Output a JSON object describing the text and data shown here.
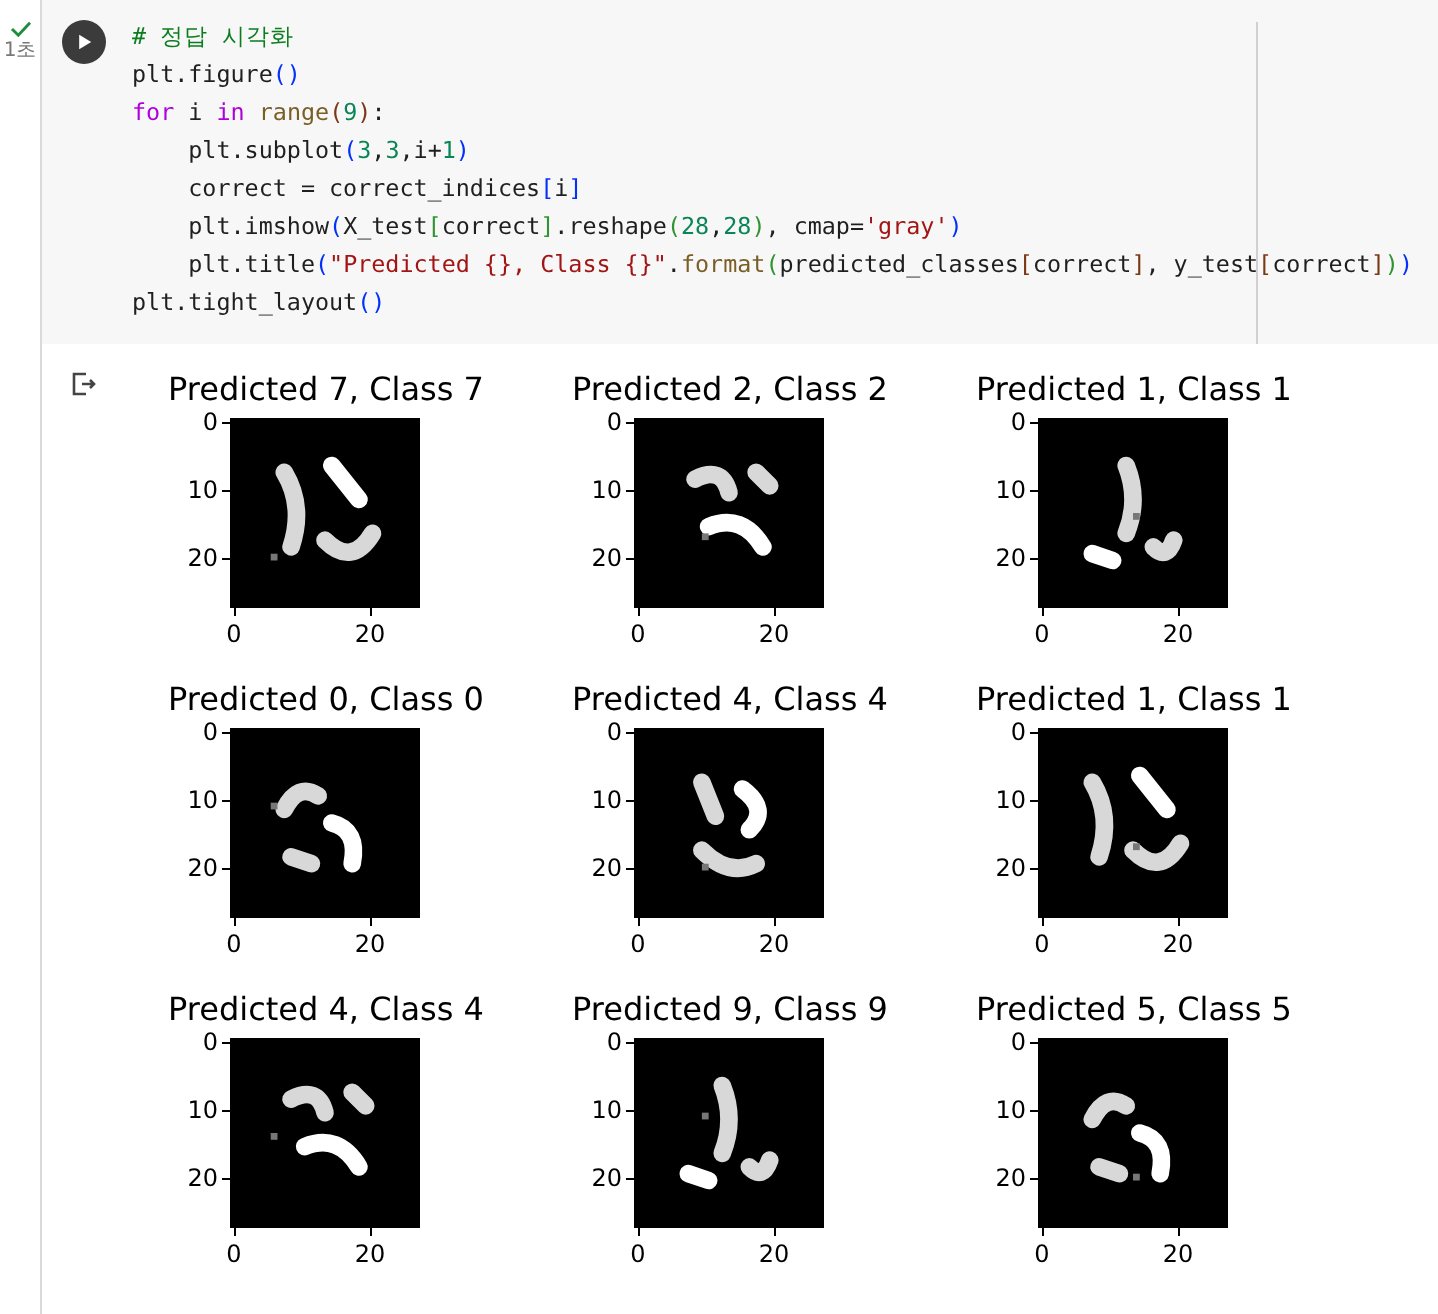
{
  "cell": {
    "status": {
      "done": true,
      "duration": "1초"
    },
    "code_lines": [
      [
        {
          "kind": "comment",
          "text": "# 정답 시각화"
        }
      ],
      [
        {
          "kind": "plain",
          "text": "plt.figure"
        },
        {
          "kind": "bracket1",
          "text": "()"
        }
      ],
      [
        {
          "kind": "keyword",
          "text": "for"
        },
        {
          "kind": "plain",
          "text": " i "
        },
        {
          "kind": "keyword",
          "text": "in"
        },
        {
          "kind": "function",
          "text": " range"
        },
        {
          "kind": "bracket3",
          "text": "("
        },
        {
          "kind": "number",
          "text": "9"
        },
        {
          "kind": "bracket3",
          "text": ")"
        },
        {
          "kind": "plain",
          "text": ":"
        }
      ],
      [
        {
          "kind": "plain",
          "text": "    plt.subplot"
        },
        {
          "kind": "bracket1",
          "text": "("
        },
        {
          "kind": "number",
          "text": "3"
        },
        {
          "kind": "plain",
          "text": ","
        },
        {
          "kind": "number",
          "text": "3"
        },
        {
          "kind": "plain",
          "text": ",i+"
        },
        {
          "kind": "number",
          "text": "1"
        },
        {
          "kind": "bracket1",
          "text": ")"
        }
      ],
      [
        {
          "kind": "plain",
          "text": "    correct = correct_indices"
        },
        {
          "kind": "bracket1",
          "text": "["
        },
        {
          "kind": "plain",
          "text": "i"
        },
        {
          "kind": "bracket1",
          "text": "]"
        }
      ],
      [
        {
          "kind": "plain",
          "text": "    plt.imshow"
        },
        {
          "kind": "bracket1",
          "text": "("
        },
        {
          "kind": "plain",
          "text": "X_test"
        },
        {
          "kind": "bracket2",
          "text": "["
        },
        {
          "kind": "plain",
          "text": "correct"
        },
        {
          "kind": "bracket2",
          "text": "]"
        },
        {
          "kind": "plain",
          "text": ".reshape"
        },
        {
          "kind": "bracket2",
          "text": "("
        },
        {
          "kind": "number",
          "text": "28"
        },
        {
          "kind": "plain",
          "text": ","
        },
        {
          "kind": "number",
          "text": "28"
        },
        {
          "kind": "bracket2",
          "text": ")"
        },
        {
          "kind": "plain",
          "text": ", cmap="
        },
        {
          "kind": "string",
          "text": "'gray'"
        },
        {
          "kind": "bracket1",
          "text": ")"
        }
      ],
      [
        {
          "kind": "plain",
          "text": "    plt.title"
        },
        {
          "kind": "bracket1",
          "text": "("
        },
        {
          "kind": "string",
          "text": "\"Predicted {}, Class {}\""
        },
        {
          "kind": "plain",
          "text": "."
        },
        {
          "kind": "function",
          "text": "format"
        },
        {
          "kind": "bracket2",
          "text": "("
        },
        {
          "kind": "plain",
          "text": "predicted_classes"
        },
        {
          "kind": "bracket3",
          "text": "["
        },
        {
          "kind": "plain",
          "text": "correct"
        },
        {
          "kind": "bracket3",
          "text": "]"
        },
        {
          "kind": "plain",
          "text": ", y_test"
        },
        {
          "kind": "bracket3",
          "text": "["
        },
        {
          "kind": "plain",
          "text": "correct"
        },
        {
          "kind": "bracket3",
          "text": "]"
        },
        {
          "kind": "bracket2",
          "text": ")"
        },
        {
          "kind": "bracket1",
          "text": ")"
        }
      ],
      [
        {
          "kind": "plain",
          "text": "plt.tight_layout"
        },
        {
          "kind": "bracket1",
          "text": "()"
        }
      ]
    ]
  },
  "output": {
    "plots": [
      {
        "title": "Predicted 7, Class 7",
        "yticks": [
          "0",
          "10",
          "20"
        ],
        "xticks": [
          "0",
          "20"
        ]
      },
      {
        "title": "Predicted 2, Class 2",
        "yticks": [
          "0",
          "10",
          "20"
        ],
        "xticks": [
          "0",
          "20"
        ]
      },
      {
        "title": "Predicted 1, Class 1",
        "yticks": [
          "0",
          "10",
          "20"
        ],
        "xticks": [
          "0",
          "20"
        ]
      },
      {
        "title": "Predicted 0, Class 0",
        "yticks": [
          "0",
          "10",
          "20"
        ],
        "xticks": [
          "0",
          "20"
        ]
      },
      {
        "title": "Predicted 4, Class 4",
        "yticks": [
          "0",
          "10",
          "20"
        ],
        "xticks": [
          "0",
          "20"
        ]
      },
      {
        "title": "Predicted 1, Class 1",
        "yticks": [
          "0",
          "10",
          "20"
        ],
        "xticks": [
          "0",
          "20"
        ]
      },
      {
        "title": "Predicted 4, Class 4",
        "yticks": [
          "0",
          "10",
          "20"
        ],
        "xticks": [
          "0",
          "20"
        ]
      },
      {
        "title": "Predicted 9, Class 9",
        "yticks": [
          "0",
          "10",
          "20"
        ],
        "xticks": [
          "0",
          "20"
        ]
      },
      {
        "title": "Predicted 5, Class 5",
        "yticks": [
          "0",
          "10",
          "20"
        ],
        "xticks": [
          "0",
          "20"
        ]
      }
    ]
  }
}
